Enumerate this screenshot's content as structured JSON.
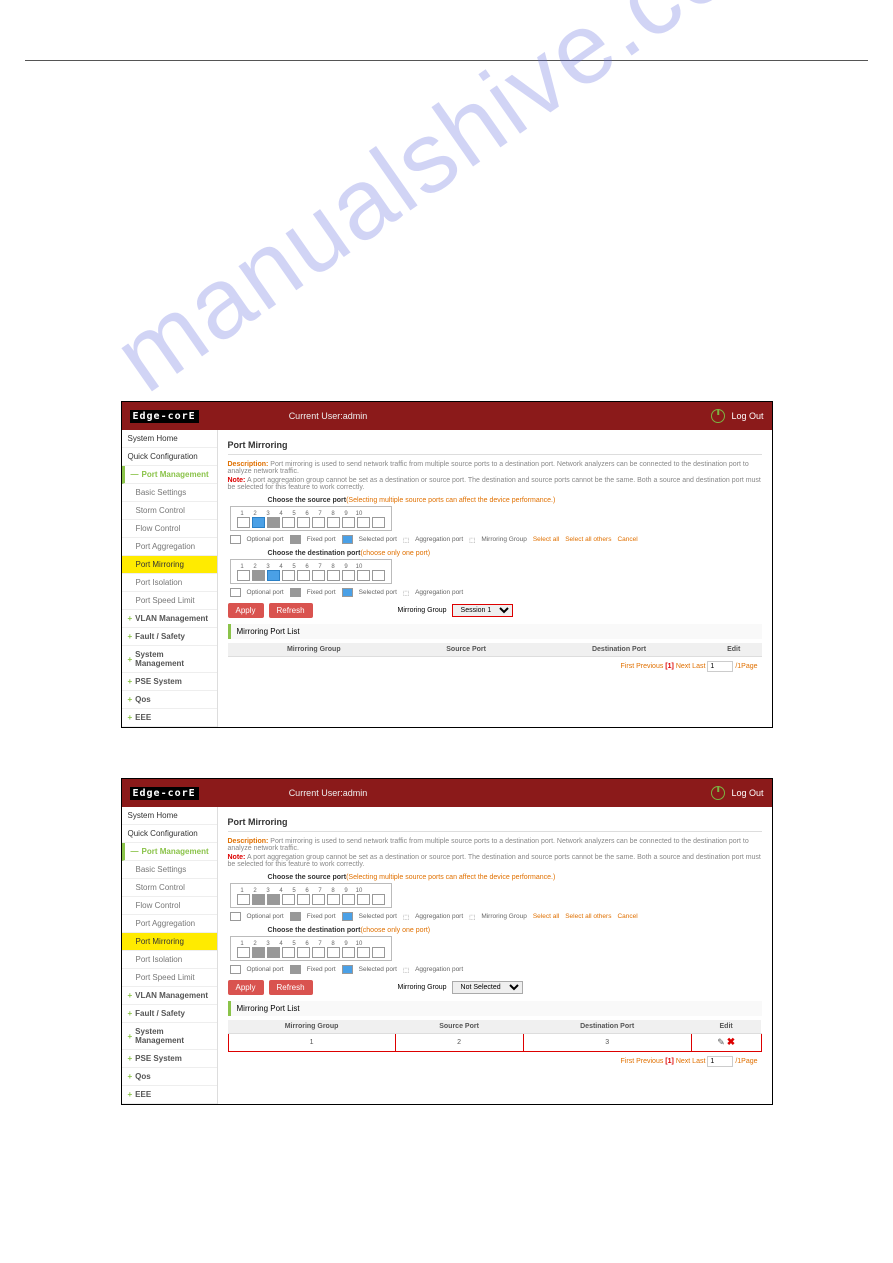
{
  "watermark": "manualshive.com",
  "header": {
    "logo": "Edge-corE",
    "current_user_label": "Current User:admin",
    "logout_label": "Log Out"
  },
  "sidebar": {
    "items": [
      {
        "label": "System Home"
      },
      {
        "label": "Quick Configuration"
      },
      {
        "label": "Port Management"
      },
      {
        "label": "Basic Settings"
      },
      {
        "label": "Storm Control"
      },
      {
        "label": "Flow Control"
      },
      {
        "label": "Port Aggregation"
      },
      {
        "label": "Port Mirroring"
      },
      {
        "label": "Port Isolation"
      },
      {
        "label": "Port Speed Limit"
      },
      {
        "label": "VLAN Management"
      },
      {
        "label": "Fault / Safety"
      },
      {
        "label": "System Management"
      },
      {
        "label": "PSE System"
      },
      {
        "label": "Qos"
      },
      {
        "label": "EEE"
      }
    ]
  },
  "panel": {
    "title": "Port Mirroring",
    "desc_label": "Description:",
    "desc_text": "Port mirroring is used to send network traffic from multiple source ports to a destination port. Network analyzers can be connected to the destination port to analyze network traffic.",
    "note_label": "Note:",
    "note_text": "A port aggregation group cannot be set as a destination or source port. The destination and source ports cannot be the same. Both a source and destination port must be selected for this feature to work correctly.",
    "src_label": "Choose the source port",
    "src_hint": "(Selecting multiple source ports can affect the device performance.)",
    "dst_label": "Choose the destination port",
    "dst_hint": "(choose only one port)",
    "port_numbers": [
      "1",
      "2",
      "3",
      "4",
      "5",
      "6",
      "7",
      "8",
      "9",
      "10"
    ],
    "legend": {
      "optional": "Optional port",
      "fixed": "Fixed port",
      "selected": "Selected port",
      "agg": "Aggregation port",
      "mg": "Mirroring Group",
      "select_all": "Select all",
      "select_others": "Select all others",
      "cancel": "Cancel"
    },
    "apply_label": "Apply",
    "refresh_label": "Refresh",
    "mg_label": "Mirroring Group",
    "mg_value1": "Session 1",
    "mg_value2": "Not Selected",
    "list_header": "Mirroring Port List",
    "table": {
      "headers": {
        "mg": "Mirroring Group",
        "sp": "Source Port",
        "dp": "Destination Port",
        "ed": "Edit"
      }
    },
    "pager": {
      "first": "First",
      "prev": "Previous",
      "page": "[1]",
      "next": "Next",
      "last": "Last",
      "pageinput": "1",
      "suffix": "/1Page"
    }
  },
  "shot2_row": {
    "mg": "1",
    "sp": "2",
    "dp": "3"
  }
}
